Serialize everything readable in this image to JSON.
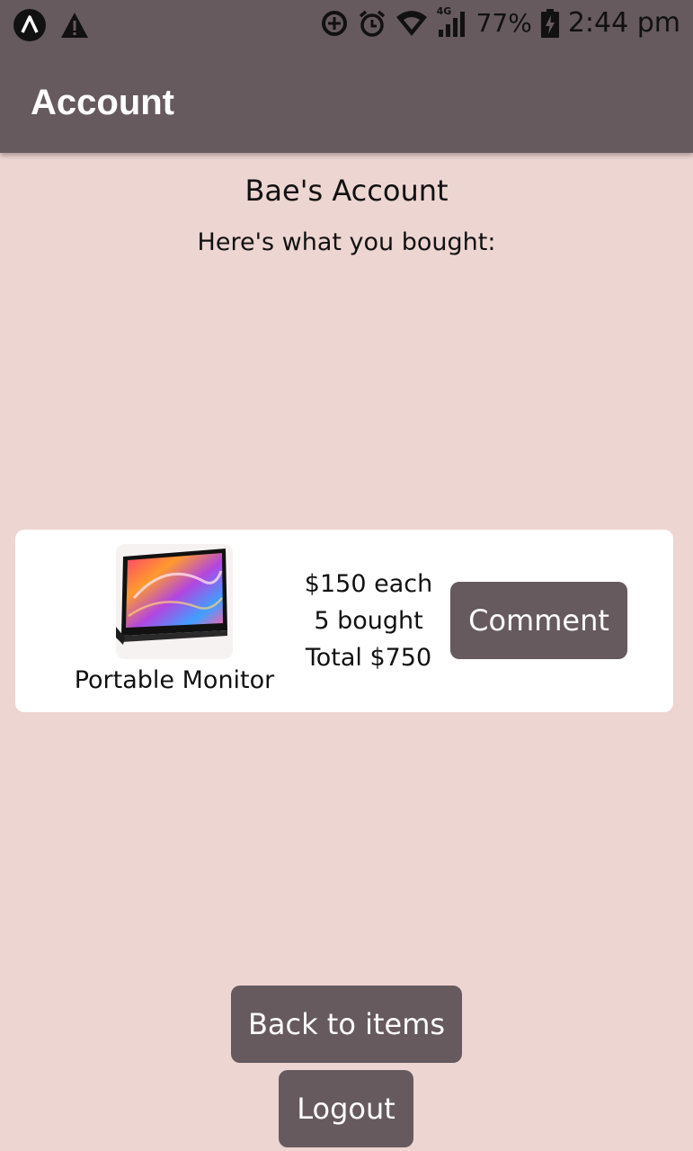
{
  "status_bar": {
    "left_icons": [
      "app-a-icon",
      "warning-icon"
    ],
    "right_icons": [
      "data-saver-icon",
      "alarm-icon",
      "wifi-icon",
      "signal-4g-icon",
      "battery-charging-icon"
    ],
    "network_label": "4G",
    "battery_percent": "77%",
    "time": "2:44 pm"
  },
  "app_bar": {
    "title": "Account"
  },
  "account": {
    "title": "Bae's Account",
    "subtitle": "Here's what you bought:"
  },
  "purchases": [
    {
      "name": "Portable Monitor",
      "price_each": "$150 each",
      "quantity": "5 bought",
      "total": "Total $750",
      "comment_label": "Comment",
      "image_icon": "portable-monitor-image"
    }
  ],
  "actions": {
    "back_label": "Back to items",
    "logout_label": "Logout"
  },
  "colors": {
    "primary": "#665a5e",
    "background": "#edd5d2",
    "card": "#ffffff"
  }
}
